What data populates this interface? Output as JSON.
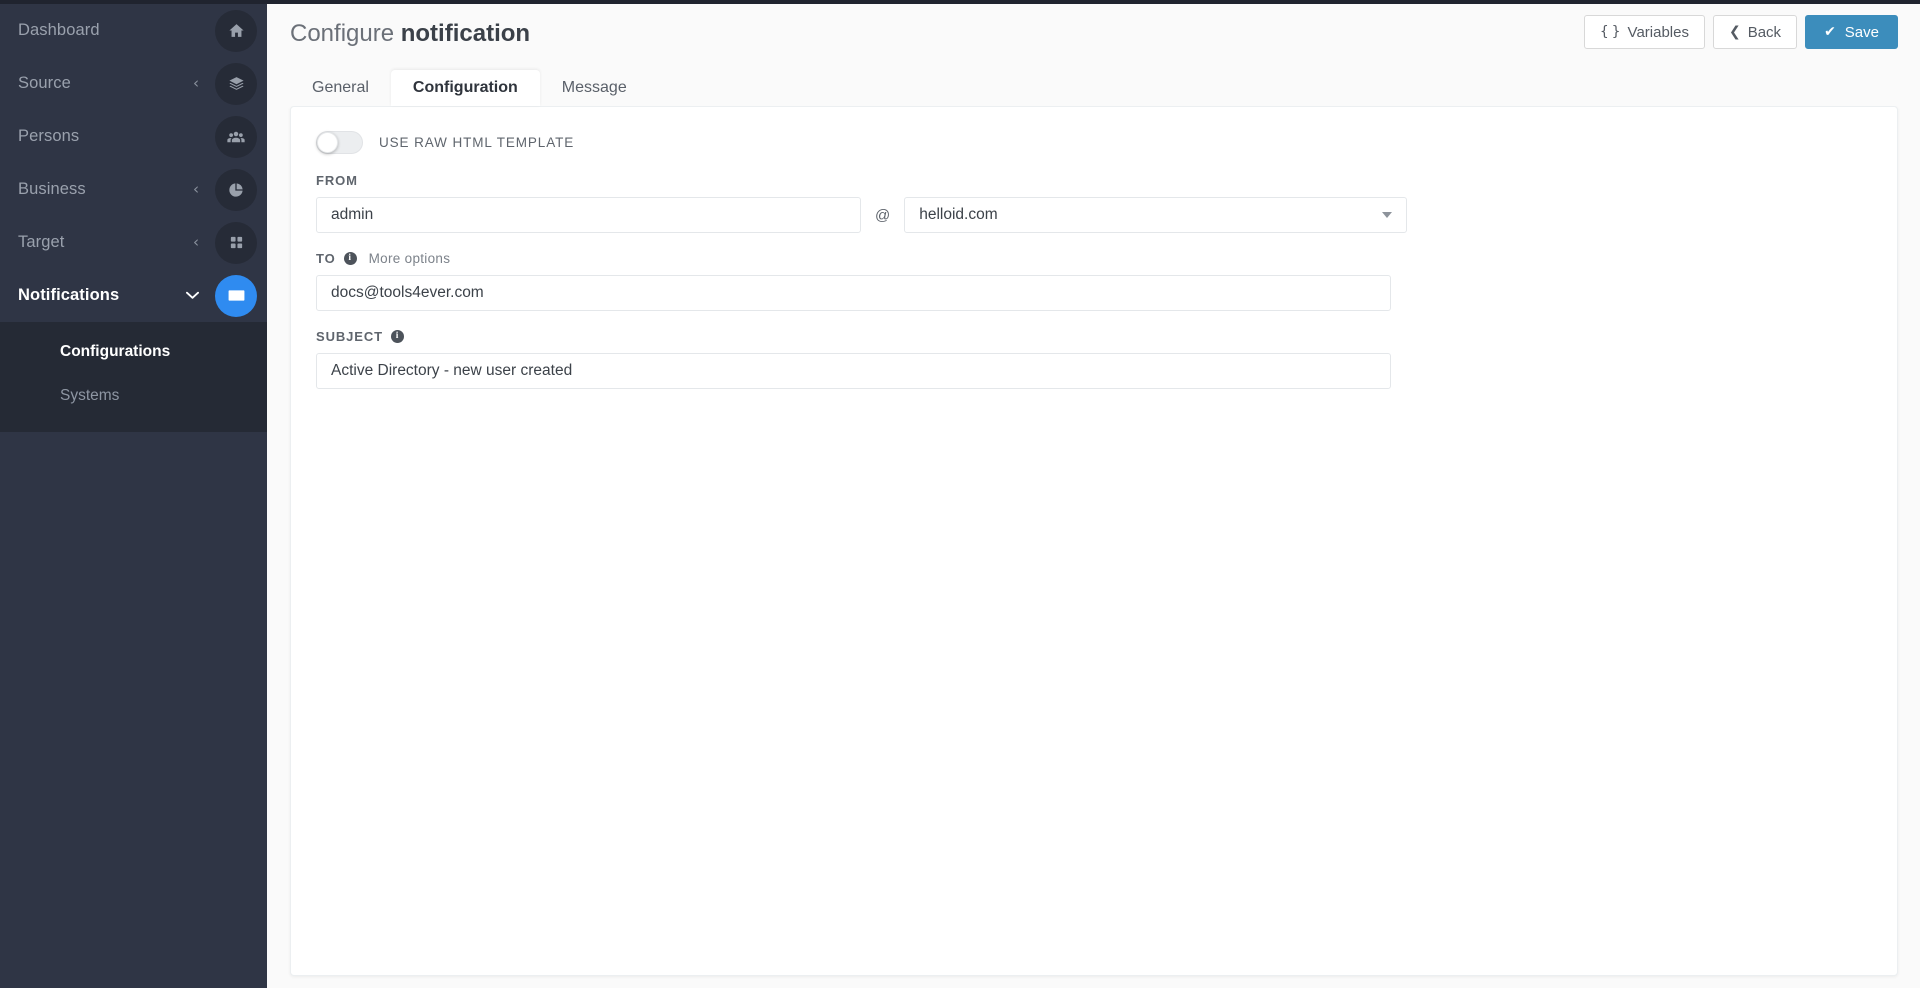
{
  "sidebar": {
    "items": [
      {
        "label": "Dashboard",
        "icon": "home-icon",
        "caret": "",
        "active": false,
        "accent": false
      },
      {
        "label": "Source",
        "icon": "layers-icon",
        "caret": "‹",
        "active": false,
        "accent": false
      },
      {
        "label": "Persons",
        "icon": "users-icon",
        "caret": "",
        "active": false,
        "accent": false
      },
      {
        "label": "Business",
        "icon": "pie-chart-icon",
        "caret": "‹",
        "active": false,
        "accent": false
      },
      {
        "label": "Target",
        "icon": "grid-icon",
        "caret": "‹",
        "active": false,
        "accent": false
      },
      {
        "label": "Notifications",
        "icon": "envelope-icon",
        "caret": "⌄",
        "active": true,
        "accent": true
      }
    ],
    "submenu": [
      {
        "label": "Configurations",
        "selected": true
      },
      {
        "label": "Systems",
        "selected": false
      }
    ],
    "accent_color": "#2f8bf0",
    "background_color": "#2f3545",
    "submenu_background_color": "#252a35"
  },
  "header": {
    "title_prefix": "Configure ",
    "title_strong": "notification",
    "buttons": [
      {
        "label": "Variables",
        "icon": "braces-icon",
        "style": "default"
      },
      {
        "label": "Back",
        "icon": "chevron-left-icon",
        "style": "default"
      },
      {
        "label": "Save",
        "icon": "check-icon",
        "style": "primary"
      }
    ],
    "primary_color": "#3c8dbc"
  },
  "tabs": [
    {
      "label": "General",
      "active": false
    },
    {
      "label": "Configuration",
      "active": true
    },
    {
      "label": "Message",
      "active": false
    }
  ],
  "form": {
    "raw_html_toggle": {
      "label": "USE RAW HTML TEMPLATE",
      "checked": false
    },
    "from": {
      "label": "FROM",
      "local_part": "admin",
      "at": "@",
      "domain": "helloid.com"
    },
    "to": {
      "label": "TO",
      "info_icon": "info-icon",
      "more_options_label": "More options",
      "value": "docs@tools4ever.com"
    },
    "subject": {
      "label": "SUBJECT",
      "info_icon": "info-icon",
      "value": "Active Directory - new user created"
    }
  }
}
